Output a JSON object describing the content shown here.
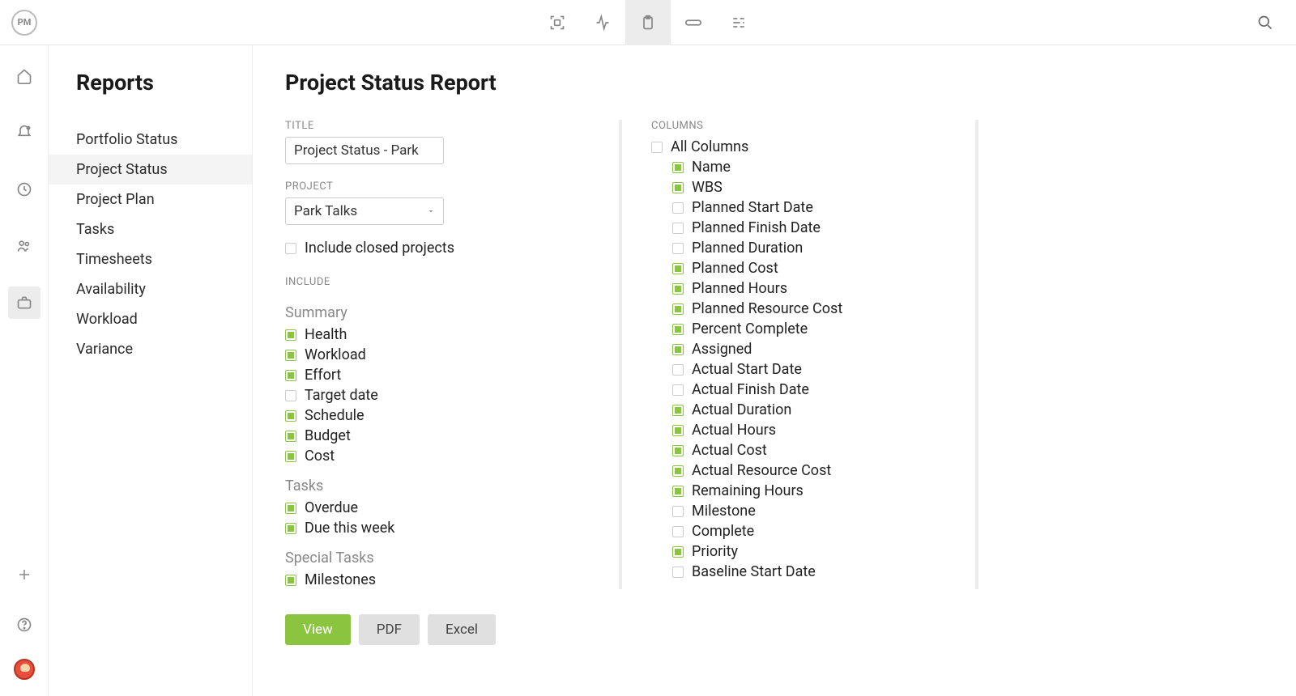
{
  "app": {
    "logo_text": "PM"
  },
  "sidebar": {
    "title": "Reports",
    "items": [
      {
        "label": "Portfolio Status",
        "active": false
      },
      {
        "label": "Project Status",
        "active": true
      },
      {
        "label": "Project Plan",
        "active": false
      },
      {
        "label": "Tasks",
        "active": false
      },
      {
        "label": "Timesheets",
        "active": false
      },
      {
        "label": "Availability",
        "active": false
      },
      {
        "label": "Workload",
        "active": false
      },
      {
        "label": "Variance",
        "active": false
      }
    ]
  },
  "page": {
    "title": "Project Status Report",
    "labels": {
      "title": "TITLE",
      "project": "PROJECT",
      "include": "INCLUDE",
      "columns": "COLUMNS"
    },
    "title_value": "Project Status - Park",
    "project_value": "Park Talks",
    "include_closed_label": "Include closed projects",
    "include_closed_checked": false,
    "include_groups": [
      {
        "heading": "Summary",
        "items": [
          {
            "label": "Health",
            "checked": true
          },
          {
            "label": "Workload",
            "checked": true
          },
          {
            "label": "Effort",
            "checked": true
          },
          {
            "label": "Target date",
            "checked": false
          },
          {
            "label": "Schedule",
            "checked": true
          },
          {
            "label": "Budget",
            "checked": true
          },
          {
            "label": "Cost",
            "checked": true
          }
        ]
      },
      {
        "heading": "Tasks",
        "items": [
          {
            "label": "Overdue",
            "checked": true
          },
          {
            "label": "Due this week",
            "checked": true
          }
        ]
      },
      {
        "heading": "Special Tasks",
        "items": [
          {
            "label": "Milestones",
            "checked": true
          }
        ]
      }
    ],
    "columns_all_label": "All Columns",
    "columns_all_checked": false,
    "columns": [
      {
        "label": "Name",
        "checked": true
      },
      {
        "label": "WBS",
        "checked": true
      },
      {
        "label": "Planned Start Date",
        "checked": false
      },
      {
        "label": "Planned Finish Date",
        "checked": false
      },
      {
        "label": "Planned Duration",
        "checked": false
      },
      {
        "label": "Planned Cost",
        "checked": true
      },
      {
        "label": "Planned Hours",
        "checked": true
      },
      {
        "label": "Planned Resource Cost",
        "checked": true
      },
      {
        "label": "Percent Complete",
        "checked": true
      },
      {
        "label": "Assigned",
        "checked": true
      },
      {
        "label": "Actual Start Date",
        "checked": false
      },
      {
        "label": "Actual Finish Date",
        "checked": false
      },
      {
        "label": "Actual Duration",
        "checked": true
      },
      {
        "label": "Actual Hours",
        "checked": true
      },
      {
        "label": "Actual Cost",
        "checked": true
      },
      {
        "label": "Actual Resource Cost",
        "checked": true
      },
      {
        "label": "Remaining Hours",
        "checked": true
      },
      {
        "label": "Milestone",
        "checked": false
      },
      {
        "label": "Complete",
        "checked": false
      },
      {
        "label": "Priority",
        "checked": true
      },
      {
        "label": "Baseline Start Date",
        "checked": false
      }
    ],
    "buttons": {
      "view": "View",
      "pdf": "PDF",
      "excel": "Excel"
    }
  }
}
